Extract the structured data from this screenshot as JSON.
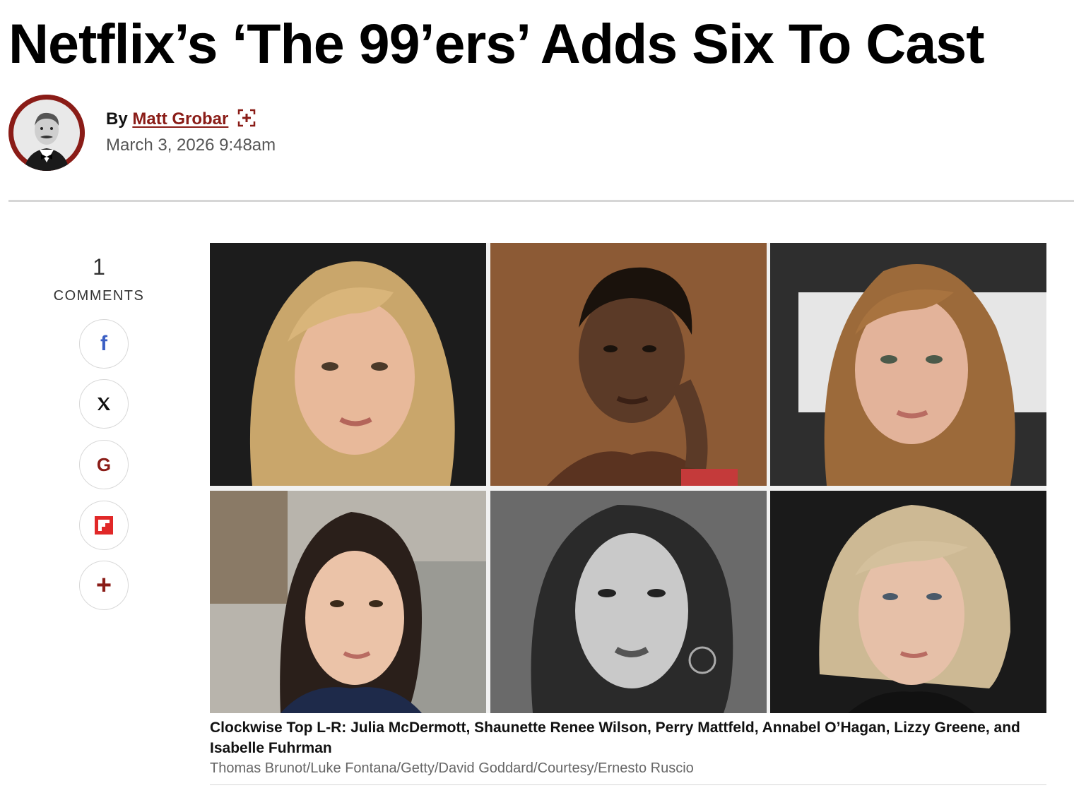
{
  "article": {
    "headline": "Netflix’s ‘The 99’ers’ Adds Six To Cast",
    "byline_prefix": "By",
    "author": "Matt Grobar",
    "date": "March 3, 2026 9:48am"
  },
  "sidebar": {
    "comment_count": "1",
    "comments_label": "COMMENTS",
    "share_buttons": [
      {
        "icon": "facebook-icon",
        "glyph": "f",
        "color": "#3b5fc4"
      },
      {
        "icon": "x-icon",
        "glyph": "𝕏",
        "color": "#111111"
      },
      {
        "icon": "google-icon",
        "glyph": "G",
        "color": "#8a1c17"
      },
      {
        "icon": "flipboard-icon",
        "glyph": "F",
        "color": "#e12828"
      },
      {
        "icon": "plus-icon",
        "glyph": "+",
        "color": "#8a1c17"
      }
    ]
  },
  "image": {
    "caption": "Clockwise Top L-R: Julia McDermott, Shaunette Renee Wilson, Perry Mattfeld, Annabel O’Hagan, Lizzy Greene, and Isabelle Fuhrman",
    "credit": "Thomas Brunot/Luke Fontana/Getty/David Goddard/Courtesy/Ernesto Ruscio"
  },
  "colors": {
    "brand": "#8a1c17"
  }
}
